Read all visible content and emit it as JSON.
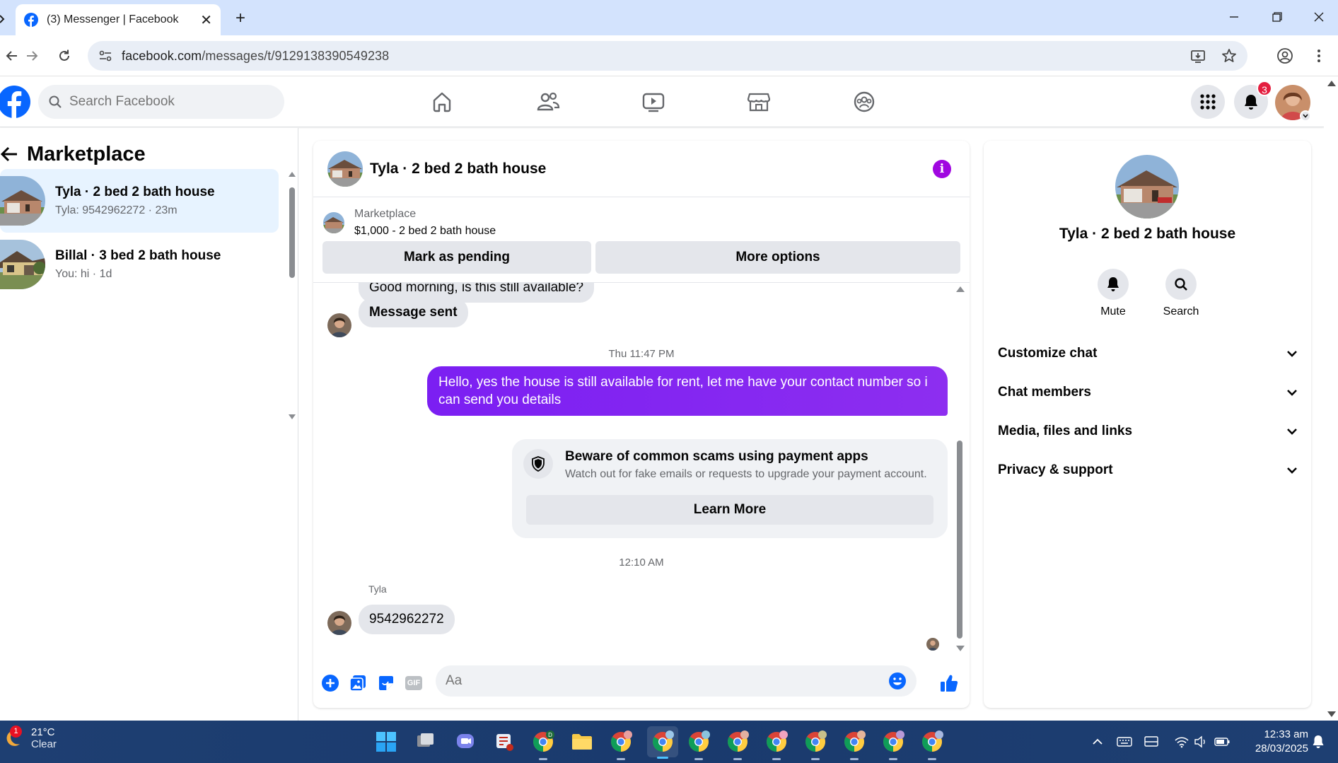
{
  "browser": {
    "tab_title": "(3) Messenger | Facebook",
    "url_domain": "facebook.com",
    "url_path": "/messages/t/9129138390549238"
  },
  "fb": {
    "search_placeholder": "Search Facebook",
    "notification_count": "3"
  },
  "sidebar": {
    "title": "Marketplace",
    "chats": [
      {
        "name": "Tyla · 2 bed 2 bath house",
        "sub": "Tyla: 9542962272 · 23m"
      },
      {
        "name": "Billal · 3 bed 2 bath house",
        "sub": "You: hi · 1d"
      }
    ]
  },
  "conversation": {
    "title": "Tyla · 2 bed 2 bath house",
    "marketplace_label": "Marketplace",
    "listing": "$1,000 - 2 bed 2 bath house",
    "mark_pending": "Mark as pending",
    "more_options": "More options",
    "messages": {
      "partial_in": "Good morning, is this still available?",
      "sent_notice": "Message sent",
      "ts1": "Thu 11:47 PM",
      "out1": "Hello, yes the house is still available for rent, let me have your contact number so i can send you details",
      "scam_title": "Beware of common scams using payment apps",
      "scam_desc": "Watch out for fake emails or requests to upgrade your payment account.",
      "learn_more": "Learn More",
      "ts2": "12:10 AM",
      "sender": "Tyla",
      "in_number": "9542962272"
    },
    "composer_placeholder": "Aa",
    "gif_label": "GIF"
  },
  "details": {
    "name": "Tyla · 2 bed 2 bath house",
    "mute": "Mute",
    "search": "Search",
    "sections": [
      "Customize chat",
      "Chat members",
      "Media, files and links",
      "Privacy & support"
    ]
  },
  "taskbar": {
    "temp": "21°C",
    "condition": "Clear",
    "weather_badge": "1",
    "time": "12:33 am",
    "date": "28/03/2025"
  },
  "colors": {
    "fb_blue": "#0866ff",
    "messenger_purple": "#7b1ff2",
    "badge_red": "#e41e3f"
  }
}
